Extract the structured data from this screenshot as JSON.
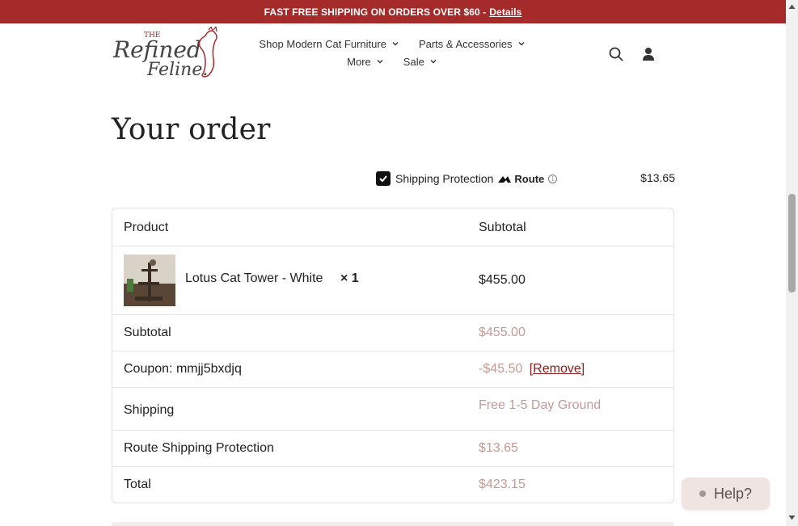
{
  "banner": {
    "text": "FAST FREE SHIPPING ON ORDERS OVER $60 -",
    "link": "Details"
  },
  "logo": {
    "top": "THE",
    "line1": "Refined",
    "line2": "Feline."
  },
  "nav": {
    "row1": [
      "Shop Modern Cat Furniture",
      "Parts & Accessories"
    ],
    "row2": [
      "More",
      "Sale"
    ]
  },
  "icons": {
    "search": "search-icon",
    "account": "user-icon"
  },
  "page_title": "Your order",
  "protection": {
    "label": "Shipping Protection",
    "brand": "Route",
    "price": "$13.65",
    "checked": true
  },
  "table": {
    "header": {
      "product": "Product",
      "subtotal": "Subtotal"
    },
    "item": {
      "name": "Lotus Cat Tower - White",
      "qty": "× 1",
      "price": "$455.00"
    },
    "rows": [
      {
        "label": "Subtotal",
        "value": "$455.00"
      },
      {
        "label": "Coupon: mmjj5bxdjq",
        "value": "-$45.50",
        "action": "[Remove]"
      },
      {
        "label": "Shipping",
        "value": "Free 1-5 Day Ground"
      },
      {
        "label": "Route Shipping Protection",
        "value": "$13.65"
      },
      {
        "label": "Total",
        "value": "$423.15"
      }
    ]
  },
  "help": {
    "label": "Help?"
  },
  "colors": {
    "banner": "#a52a2a",
    "muted_price": "#c49a96",
    "remove_link": "#8b1c1c"
  }
}
